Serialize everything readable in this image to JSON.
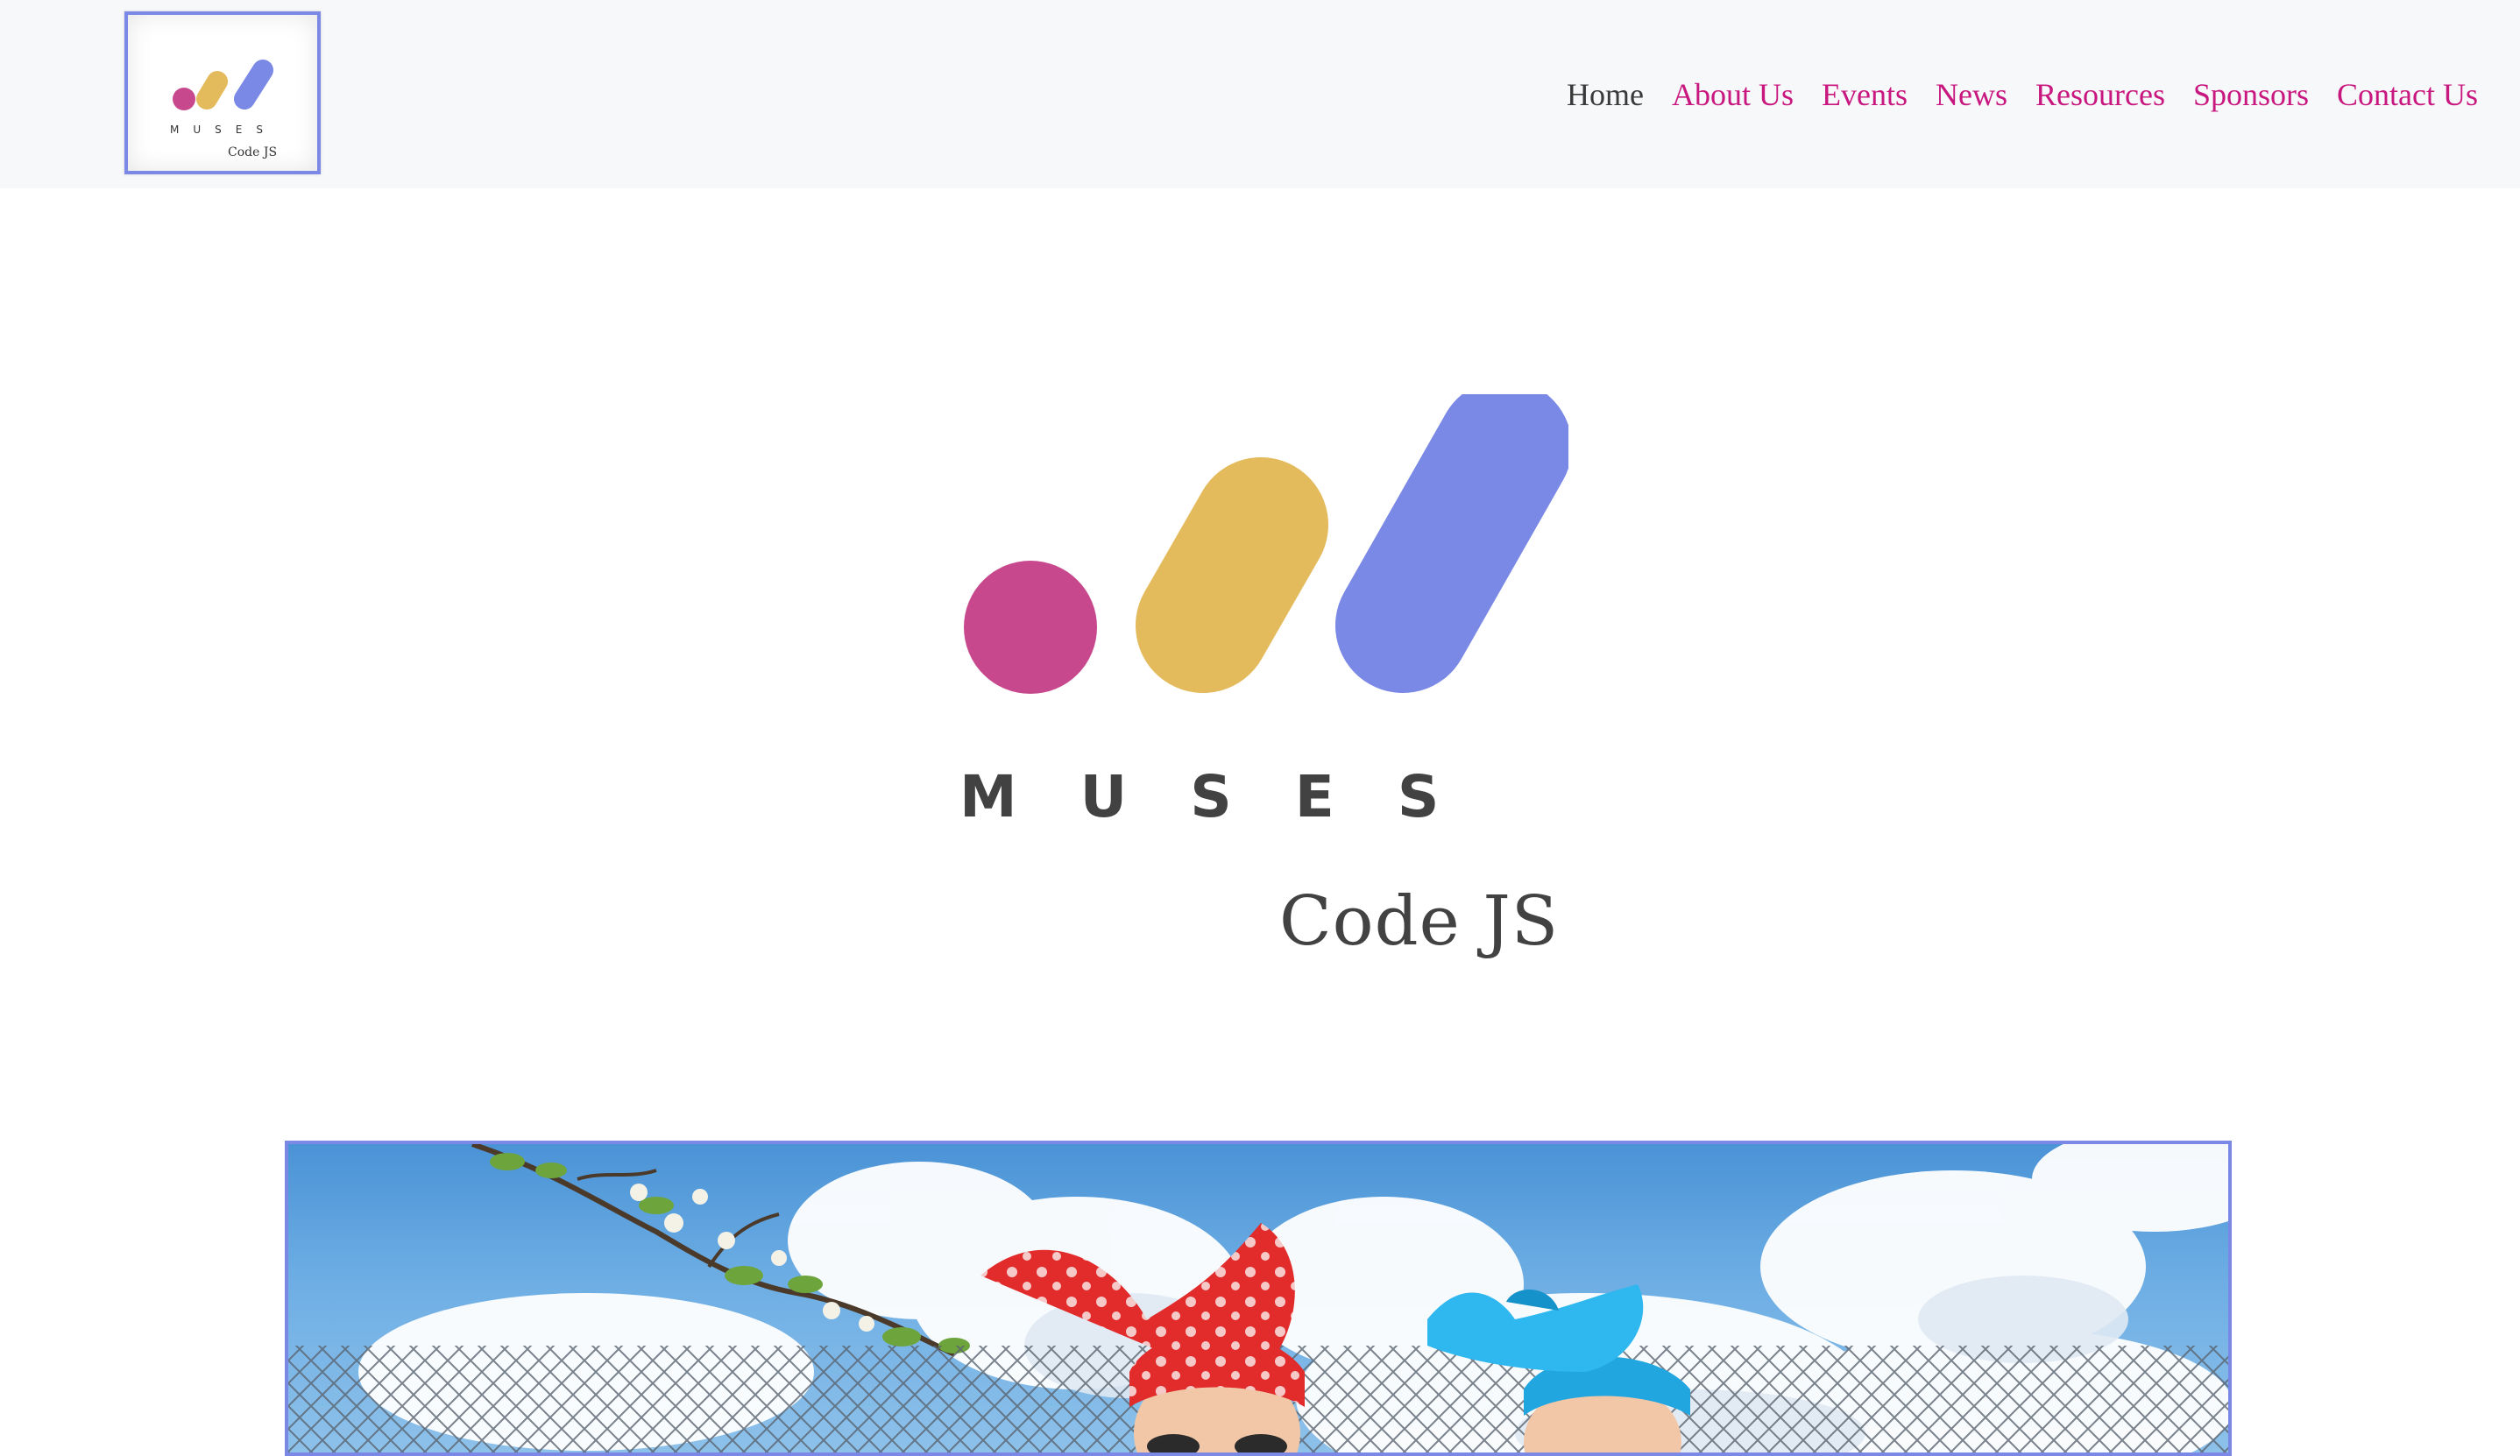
{
  "nav": {
    "logo": {
      "wordmark": "MUSES",
      "subtitle": "Code JS"
    },
    "links": [
      {
        "label": "Home",
        "active": true
      },
      {
        "label": "About Us",
        "active": false
      },
      {
        "label": "Events",
        "active": false
      },
      {
        "label": "News",
        "active": false
      },
      {
        "label": "Resources",
        "active": false
      },
      {
        "label": "Sponsors",
        "active": false
      },
      {
        "label": "Contact Us",
        "active": false
      }
    ]
  },
  "hero": {
    "wordmark": "MUSES",
    "subtitle": "Code JS"
  },
  "colors": {
    "brand_pink": "#c8488e",
    "brand_yellow": "#e4bb5c",
    "brand_blue": "#7a88e6",
    "link": "#c8177f",
    "link_active": "#3a3a3a",
    "text_dark": "#424242",
    "frame_border": "#7b88e6"
  },
  "icons": {
    "logo": "muses-logo-icon",
    "hero_logo": "muses-logo-icon"
  }
}
